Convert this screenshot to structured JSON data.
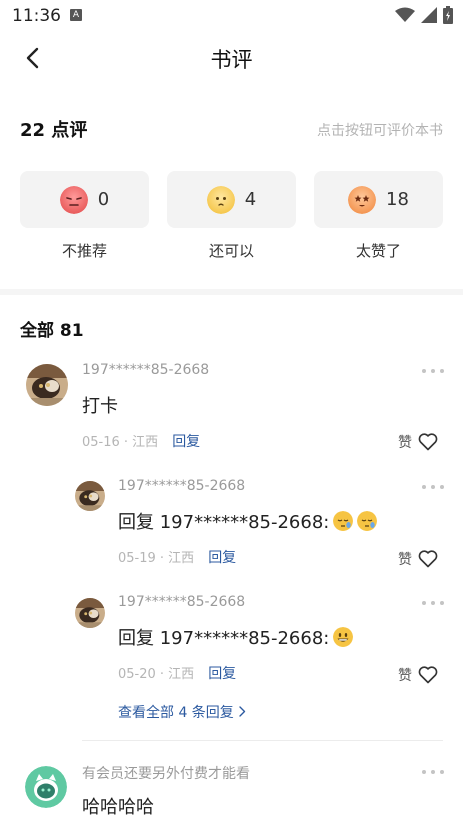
{
  "status_bar": {
    "time": "11:36",
    "a_icon": "A"
  },
  "nav": {
    "title": "书评"
  },
  "summary": {
    "count_label": "22 点评",
    "hint": "点击按钮可评价本书"
  },
  "ratings": [
    {
      "value": "0",
      "label": "不推荐",
      "icon": "frown-face-icon",
      "color": "#f06a6a"
    },
    {
      "value": "4",
      "label": "还可以",
      "icon": "neutral-face-icon",
      "color": "#f7cf5a"
    },
    {
      "value": "18",
      "label": "太赞了",
      "icon": "star-eyes-face-icon",
      "color": "#f8a25c"
    }
  ],
  "all_section": {
    "title": "全部 81"
  },
  "comments": {
    "c1": {
      "user": "197******85-2668",
      "text": "打卡",
      "date": "05-16 · 江西",
      "reply": "回复",
      "like": "赞"
    },
    "r1": {
      "user": "197******85-2668",
      "text": "回复 197******85-2668:",
      "date": "05-19 · 江西",
      "reply": "回复",
      "like": "赞",
      "emoji": "sleepy-face-icon"
    },
    "r2": {
      "user": "197******85-2668",
      "text": "回复 197******85-2668:",
      "date": "05-20 · 江西",
      "reply": "回复",
      "like": "赞",
      "emoji": "grinning-face-icon"
    },
    "view_all": "查看全部 4 条回复",
    "c2": {
      "user": "有会员还要另外付费才能看",
      "text": "哈哈哈哈"
    }
  }
}
